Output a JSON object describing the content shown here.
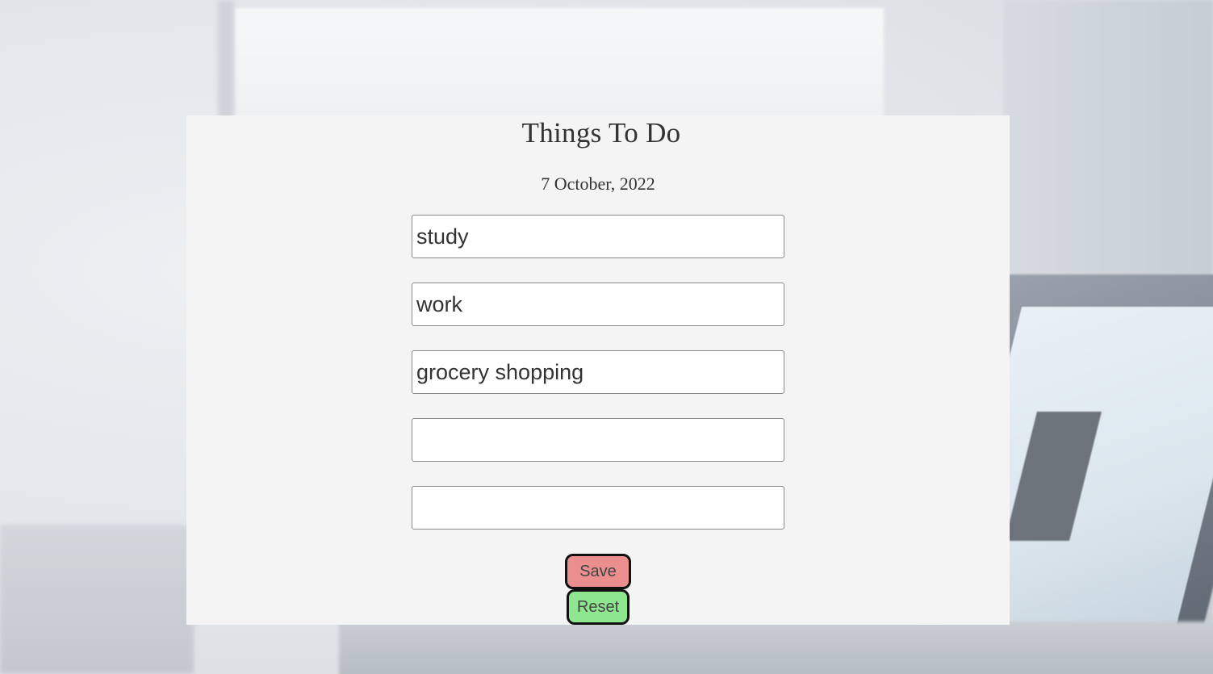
{
  "page": {
    "title": "Things To Do",
    "date": "7 October, 2022"
  },
  "tasks": [
    {
      "value": "study",
      "placeholder": ""
    },
    {
      "value": "work",
      "placeholder": ""
    },
    {
      "value": "grocery shopping",
      "placeholder": ""
    },
    {
      "value": "",
      "placeholder": ""
    },
    {
      "value": "",
      "placeholder": ""
    }
  ],
  "buttons": {
    "save_label": "Save",
    "reset_label": "Reset"
  },
  "colors": {
    "card_background": "#f4f4f4",
    "save_button": "#ea8e8e",
    "reset_button": "#8ee68e",
    "button_border": "#111111",
    "text": "#333333"
  }
}
